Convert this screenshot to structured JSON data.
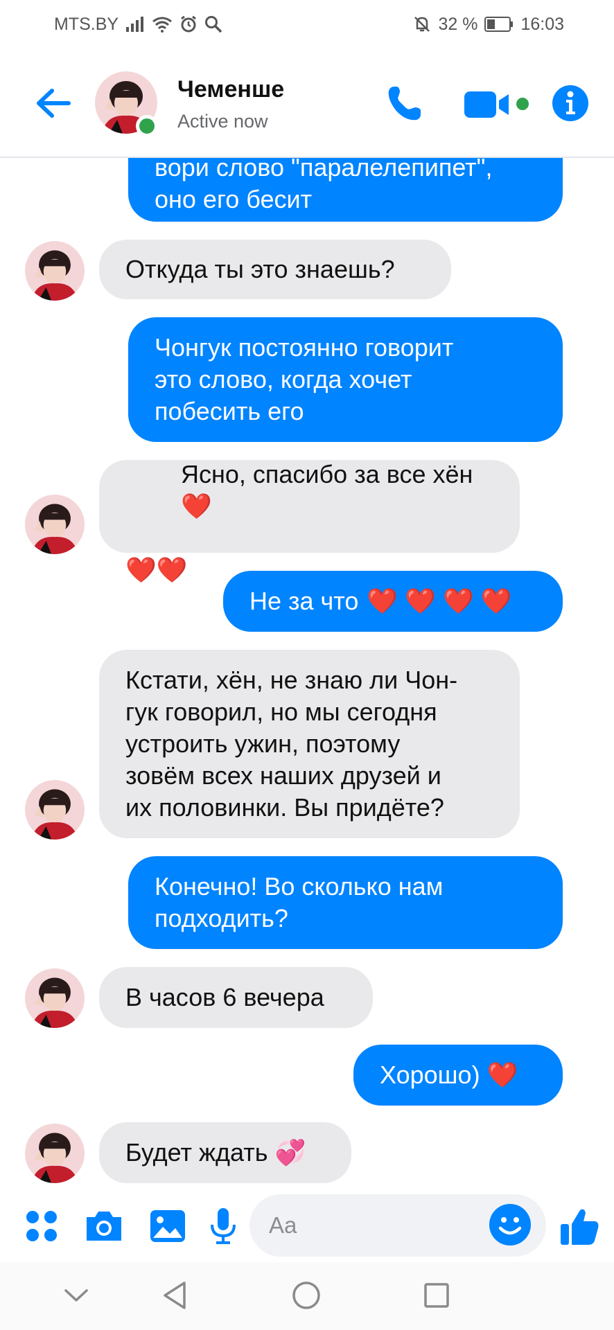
{
  "status_bar": {
    "carrier": "MTS.BY",
    "battery": "32 %",
    "time": "16:03"
  },
  "header": {
    "contact_name": "Чеменше",
    "contact_status": "Active now"
  },
  "colors": {
    "accent": "#0084ff",
    "incoming_bubble": "#e9e9eb",
    "online": "#31a24c",
    "heart": "#e0202a"
  },
  "messages": [
    {
      "direction": "out",
      "text": "вори слово \"паралелепипет\",\nоно его бесит"
    },
    {
      "direction": "in",
      "text": "Откуда ты это знаешь?"
    },
    {
      "direction": "out",
      "text": "Чонгук постоянно говорит\nэто слово, когда хочет\nпобесить его"
    },
    {
      "direction": "in",
      "text": "Ясно, спасибо за все хён",
      "hearts_inline": "❤️",
      "hearts_next": "❤️❤️"
    },
    {
      "direction": "out",
      "text": "Не за что",
      "hearts": "❤️ ❤️ ❤️ ❤️"
    },
    {
      "direction": "in",
      "text": "Кстати, хён, не знаю ли Чон-\nгук говорил, но мы сегодня\nустроить ужин, поэтому\nзовём всех наших друзей и\nих половинки. Вы придёте?"
    },
    {
      "direction": "out",
      "text": "Конечно! Во сколько нам\nподходить?"
    },
    {
      "direction": "in",
      "text": "В часов 6 вечера"
    },
    {
      "direction": "out",
      "text": "Хорошо)",
      "hearts": "❤️"
    },
    {
      "direction": "in",
      "text": "Будет ждать",
      "emoji": "💞"
    }
  ],
  "composer": {
    "placeholder": "Aa"
  },
  "icons": {
    "back": "arrow-left-icon",
    "call": "phone-icon",
    "video": "video-camera-icon",
    "info": "info-icon",
    "menu": "four-dots-icon",
    "camera": "camera-icon",
    "gallery": "image-icon",
    "mic": "microphone-icon",
    "emoji": "smiley-icon",
    "like": "thumbs-up-icon"
  }
}
